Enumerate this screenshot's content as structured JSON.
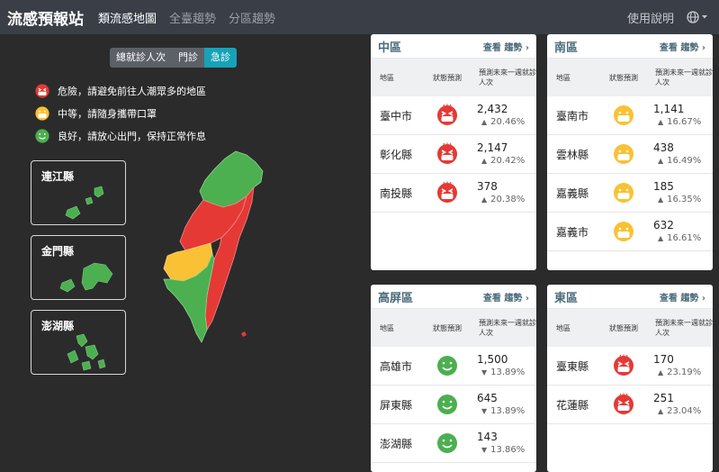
{
  "nav": {
    "brand": "流感預報站",
    "links": [
      {
        "label": "類流感地圖",
        "active": true
      },
      {
        "label": "全臺趨勢",
        "active": false
      },
      {
        "label": "分區趨勢",
        "active": false
      }
    ],
    "help": "使用說明",
    "globe_icon": "globe-icon"
  },
  "toggle": [
    {
      "label": "總就診人次",
      "active": false
    },
    {
      "label": "門診",
      "active": false
    },
    {
      "label": "急診",
      "active": true
    }
  ],
  "legend": [
    {
      "level": "danger",
      "text": "危險，請避免前往人潮眾多的地區"
    },
    {
      "level": "medium",
      "text": "中等，請隨身攜帶口罩"
    },
    {
      "level": "good",
      "text": "良好，請放心出門，保持正常作息"
    }
  ],
  "islands": [
    "連江縣",
    "金門縣",
    "澎湖縣"
  ],
  "colors": {
    "danger": "#e53935",
    "medium": "#f9c133",
    "good": "#4caf50"
  },
  "headers": {
    "area": "地區",
    "status": "狀態預測",
    "forecast": "預測未來一週就診人次"
  },
  "cards": [
    {
      "name": "中區",
      "more": "查看 趨勢",
      "rows": [
        {
          "area": "臺中市",
          "level": "danger",
          "count": "2,432",
          "dir": "up",
          "pct": "20.46%"
        },
        {
          "area": "彰化縣",
          "level": "danger",
          "count": "2,147",
          "dir": "up",
          "pct": "20.42%"
        },
        {
          "area": "南投縣",
          "level": "danger",
          "count": "378",
          "dir": "up",
          "pct": "20.38%"
        }
      ]
    },
    {
      "name": "南區",
      "more": "查看 趨勢",
      "rows": [
        {
          "area": "臺南市",
          "level": "medium",
          "count": "1,141",
          "dir": "up",
          "pct": "16.67%"
        },
        {
          "area": "雲林縣",
          "level": "medium",
          "count": "438",
          "dir": "up",
          "pct": "16.49%"
        },
        {
          "area": "嘉義縣",
          "level": "medium",
          "count": "185",
          "dir": "up",
          "pct": "16.35%"
        },
        {
          "area": "嘉義市",
          "level": "medium",
          "count": "632",
          "dir": "up",
          "pct": "16.61%"
        }
      ]
    },
    {
      "name": "高屏區",
      "more": "查看 趨勢",
      "rows": [
        {
          "area": "高雄市",
          "level": "good",
          "count": "1,500",
          "dir": "down",
          "pct": "13.89%"
        },
        {
          "area": "屏東縣",
          "level": "good",
          "count": "645",
          "dir": "down",
          "pct": "13.89%"
        },
        {
          "area": "澎湖縣",
          "level": "good",
          "count": "143",
          "dir": "down",
          "pct": "13.86%"
        }
      ]
    },
    {
      "name": "東區",
      "more": "查看 趨勢",
      "rows": [
        {
          "area": "臺東縣",
          "level": "danger",
          "count": "170",
          "dir": "up",
          "pct": "23.19%"
        },
        {
          "area": "花蓮縣",
          "level": "danger",
          "count": "251",
          "dir": "up",
          "pct": "23.04%"
        }
      ]
    }
  ]
}
